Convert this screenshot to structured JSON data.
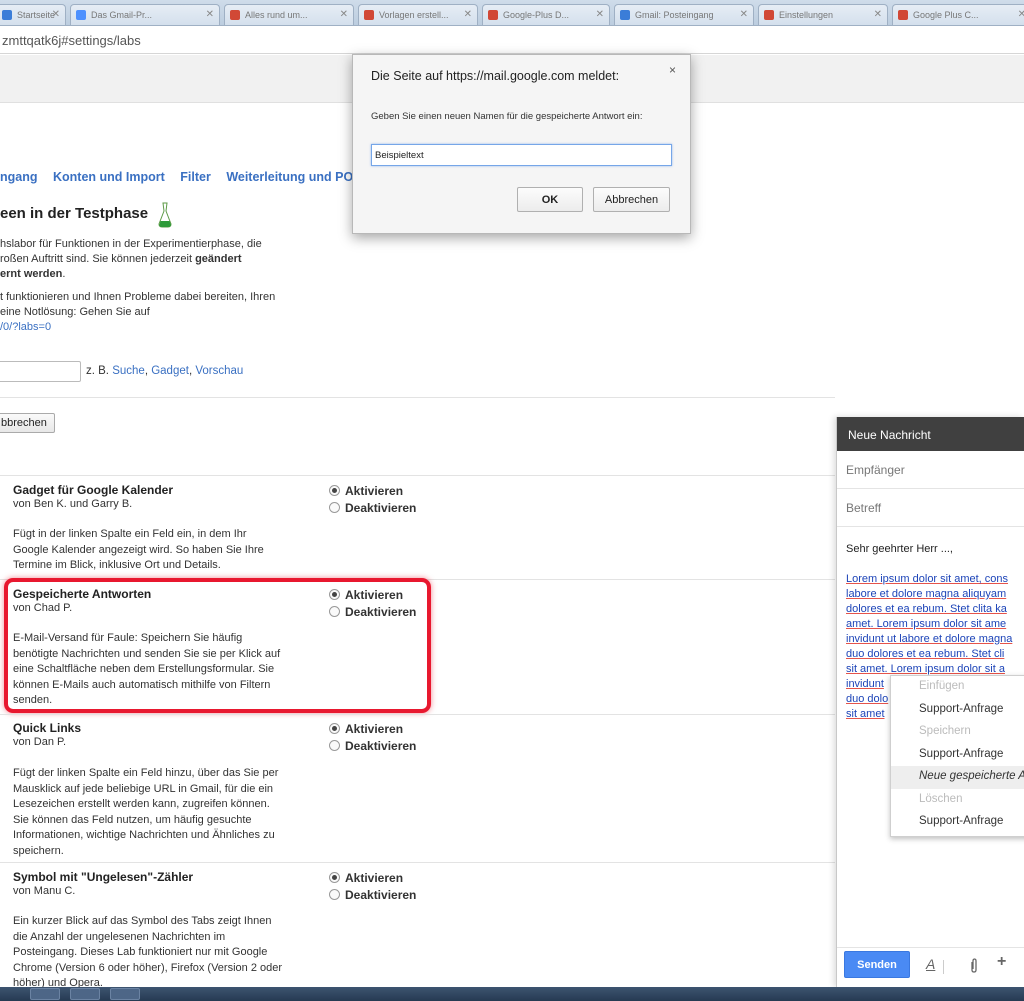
{
  "browser": {
    "tabs": [
      {
        "label": "Startseite",
        "color": "#3b7dd8"
      },
      {
        "label": "Das Gmail-Pr...",
        "color": "#4d90fe"
      },
      {
        "label": "Alles rund um...",
        "color": "#d14836"
      },
      {
        "label": "Vorlagen erstell...",
        "color": "#d14836"
      },
      {
        "label": "Google-Plus D...",
        "color": "#d14836"
      },
      {
        "label": "Gmail: Posteingang",
        "color": "#3b7dd8"
      },
      {
        "label": "Einstellungen",
        "color": "#d14836"
      },
      {
        "label": "Google Plus C...",
        "color": "#d14836"
      }
    ],
    "url": "zmttqatk6j#settings/labs"
  },
  "settings": {
    "tabs": [
      "ngang",
      "Konten und Import",
      "Filter",
      "Weiterleitung und POP"
    ],
    "labs_title": "een in der Testphase",
    "intro": {
      "line1": "hslabor für Funktionen in der Experimentierphase, die",
      "line2a": "roßen Auftritt sind. Sie können jederzeit ",
      "line2b": "geändert",
      "line3": "ernt werden",
      "line3end": ".",
      "line4": "t funktionieren und Ihnen Probleme dabei bereiten, Ihren",
      "line5": "eine Notlösung: Gehen Sie auf",
      "link": "/0/?labs=0"
    },
    "example_prefix": "z. B.",
    "example_links": [
      "Suche",
      "Gadget",
      "Vorschau"
    ],
    "cancel_label": "bbrechen",
    "activate_label": "Aktivieren",
    "deactivate_label": "Deaktivieren",
    "labs": [
      {
        "title": "Gadget für Google Kalender",
        "author": "von Ben K. und Garry B.",
        "description": [
          "Fügt in der linken Spalte ein Feld ein, in dem Ihr",
          "Google Kalender angezeigt wird. So haben Sie Ihre",
          "Termine im Blick, inklusive Ort und Details."
        ]
      },
      {
        "title": "Gespeicherte Antworten",
        "author": "von Chad P.",
        "description": [
          "E-Mail-Versand für Faule: Speichern Sie häufig",
          "benötigte Nachrichten und senden Sie sie per Klick auf",
          "eine Schaltfläche neben dem Erstellungsformular. Sie",
          "können E-Mails auch automatisch mithilfe von Filtern",
          "senden."
        ]
      },
      {
        "title": "Quick Links",
        "author": "von Dan P.",
        "description": [
          "Fügt der linken Spalte ein Feld hinzu, über das Sie per",
          "Mausklick auf jede beliebige URL in Gmail, für die ein",
          "Lesezeichen erstellt werden kann, zugreifen können.",
          "Sie können das Feld nutzen, um häufig gesuchte",
          "Informationen, wichtige Nachrichten und Ähnliches zu",
          "speichern."
        ]
      },
      {
        "title": "Symbol mit \"Ungelesen\"-Zähler",
        "author": "von Manu C.",
        "description": [
          "Ein kurzer Blick auf das Symbol des Tabs zeigt Ihnen",
          "die Anzahl der ungelesenen Nachrichten im",
          "Posteingang. Dieses Lab funktioniert nur mit Google",
          "Chrome (Version 6 oder höher), Firefox (Version 2 oder",
          "höher) und Opera."
        ]
      }
    ]
  },
  "compose": {
    "title": "Neue Nachricht",
    "to_placeholder": "Empfänger",
    "subject_placeholder": "Betreff",
    "greeting": "Sehr geehrter Herr ...,",
    "body_lines": [
      "Lorem ipsum dolor sit amet, cons",
      "labore et dolore magna aliquyam",
      "dolores et ea rebum. Stet clita ka",
      "amet. Lorem ipsum dolor sit ame",
      "invidunt ut labore et dolore magna",
      "duo dolores et ea rebum. Stet cli",
      "sit amet. Lorem ipsum dolor sit a",
      "invidunt",
      "duo dolo",
      "sit amet"
    ],
    "send_label": "Senden",
    "canned_menu": [
      {
        "label": "Einfügen",
        "disabled": true
      },
      {
        "label": "Support-Anfrage",
        "disabled": false
      },
      {
        "label": "Speichern",
        "disabled": true
      },
      {
        "label": "Support-Anfrage",
        "disabled": false
      },
      {
        "label": "Neue gespeicherte Antwort...",
        "disabled": false,
        "active": true
      },
      {
        "label": "Löschen",
        "disabled": true
      },
      {
        "label": "Support-Anfrage",
        "disabled": false
      }
    ]
  },
  "dialog": {
    "title": "Die Seite auf https://mail.google.com meldet:",
    "close_label": "×",
    "message": "Geben Sie einen neuen Namen für die gespeicherte Antwort ein:",
    "input_value": "Beispieltext",
    "ok_label": "OK",
    "cancel_label": "Abbrechen"
  },
  "colors": {
    "accent": "#3a70c2",
    "highlight": "#e8182f",
    "send": "#4a8af4"
  }
}
